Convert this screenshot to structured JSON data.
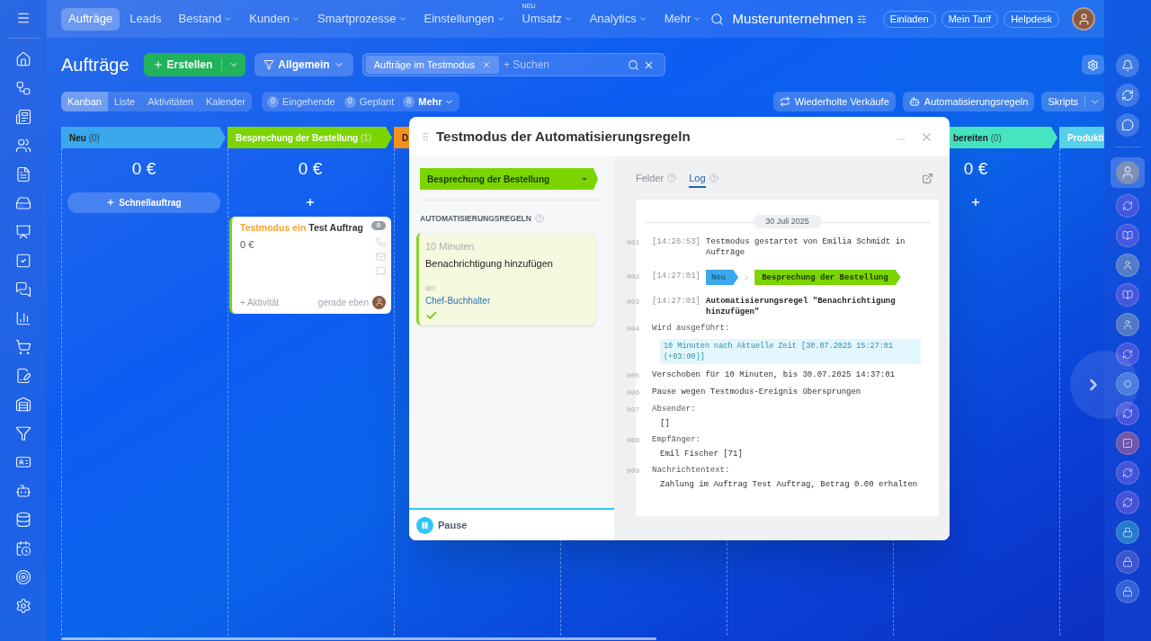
{
  "top_nav": {
    "items": [
      {
        "label": "Aufträge",
        "selected": true,
        "dropdown": false
      },
      {
        "label": "Leads",
        "selected": false,
        "dropdown": false
      },
      {
        "label": "Bestand",
        "selected": false,
        "dropdown": true
      },
      {
        "label": "Kunden",
        "selected": false,
        "dropdown": true
      },
      {
        "label": "Smartprozesse",
        "selected": false,
        "dropdown": true
      },
      {
        "label": "Einstellungen",
        "selected": false,
        "dropdown": true
      },
      {
        "label": "Umsatz",
        "selected": false,
        "dropdown": true,
        "badge": "NEU"
      },
      {
        "label": "Analytics",
        "selected": false,
        "dropdown": true
      },
      {
        "label": "Mehr",
        "selected": false,
        "dropdown": true
      }
    ],
    "company": "Musterunternehmen",
    "buttons": [
      "Einladen",
      "Mein Tarif",
      "Helpdesk"
    ]
  },
  "page": {
    "title": "Aufträge",
    "create_button": "Erstellen",
    "filter_button": "Allgemein",
    "search": {
      "chip": "Aufträge im Testmodus",
      "placeholder": "+ Suchen"
    }
  },
  "view_tabs": [
    {
      "label": "Kanban",
      "selected": true
    },
    {
      "label": "Liste",
      "selected": false
    },
    {
      "label": "Aktivitäten",
      "selected": false
    },
    {
      "label": "Kalender",
      "selected": false
    }
  ],
  "counters": [
    {
      "count": "0",
      "label": "Eingehende"
    },
    {
      "count": "0",
      "label": "Geplant"
    },
    {
      "count": "8",
      "label": "Mehr",
      "dropdown": true
    }
  ],
  "toolbar_buttons": [
    {
      "kind": "recurring",
      "label": "Wiederholte Verkäufe"
    },
    {
      "kind": "robot",
      "label": "Automatisierungsregeln"
    },
    {
      "kind": "split",
      "label": "Skripts"
    }
  ],
  "kanban": {
    "columns": [
      {
        "title": "Neu",
        "count": "(0)",
        "color": "#3ba7ec",
        "kind": "dark",
        "sum": "0 €",
        "action": {
          "kind": "quick",
          "label": "Schnellauftrag"
        }
      },
      {
        "title": "Besprechung der Bestellung",
        "count": "(1)",
        "color": "#7bd500",
        "kind": "light",
        "sum": "0 €",
        "action": {
          "kind": "plus"
        },
        "cards": [
          {
            "prefix": "Testmodus ein",
            "title": "Test Auftrag",
            "amount": "0 €",
            "badge": "0",
            "activity": "+ Aktivität",
            "time": "gerade eben"
          }
        ]
      },
      {
        "title": "D",
        "color": "#f7941d",
        "kind": "dark"
      },
      {
        "title": "bereiten",
        "count": "(0)",
        "color": "#47e4c2",
        "kind": "dark",
        "sum": "0 €",
        "action": {
          "kind": "plus"
        }
      },
      {
        "title": "Produkti",
        "color": "#55d0e8",
        "kind": "light"
      }
    ]
  },
  "modal": {
    "title": "Testmodus der Automatisierungsregeln",
    "stage": {
      "label": "Besprechung der Bestellung",
      "color": "#7bd500"
    },
    "section_title": "AUTOMATISIERUNGSREGELN",
    "rule": {
      "delay": "10 Minuten",
      "name": "Benachrichtigung hinzufügen",
      "to_label": "an:",
      "to": "Chef-Buchhalter",
      "done": true
    },
    "pause_button": "Pause",
    "tabs": [
      {
        "label": "Felder",
        "selected": false
      },
      {
        "label": "Log",
        "selected": true
      }
    ],
    "log": {
      "date": "30 Juli 2025",
      "entries": [
        {
          "num": "001",
          "time": "[14:26:53]",
          "kind": "text",
          "text": "Testmodus gestartet von Emilia Schmidt in Aufträge"
        },
        {
          "num": "002",
          "time": "[14:27:01]",
          "kind": "stages",
          "from": {
            "label": "Neu",
            "color": "#3ba7ec"
          },
          "to": {
            "label": "Besprechung der Bestellung",
            "color": "#7bd500"
          }
        },
        {
          "num": "003",
          "time": "[14:27:01]",
          "kind": "bold",
          "text": "Automatisierungsregel \"Benachrichtigung hinzufügen\""
        },
        {
          "num": "004",
          "kind": "highlight",
          "text": "Wird ausgeführt:",
          "detail": "10 Minuten nach Aktuelle Zeit [30.07.2025 15:27:01 (+03:00)]"
        },
        {
          "num": "005",
          "kind": "text",
          "text": "Verschoben für 10 Minuten, bis 30.07.2025 14:37:01"
        },
        {
          "num": "006",
          "kind": "text",
          "text": "Pause wegen Testmodus-Ereignis übersprungen"
        },
        {
          "num": "007",
          "kind": "label",
          "text": "Absender:",
          "detail": "[]"
        },
        {
          "num": "008",
          "kind": "label",
          "text": "Empfänger:",
          "detail": "Emil Fischer [71]"
        },
        {
          "num": "009",
          "kind": "label",
          "text": "Nachrichtentext:",
          "detail": "Zahlung im Auftrag Test Auftrag, Betrag 0.00 erhalten"
        }
      ]
    }
  }
}
